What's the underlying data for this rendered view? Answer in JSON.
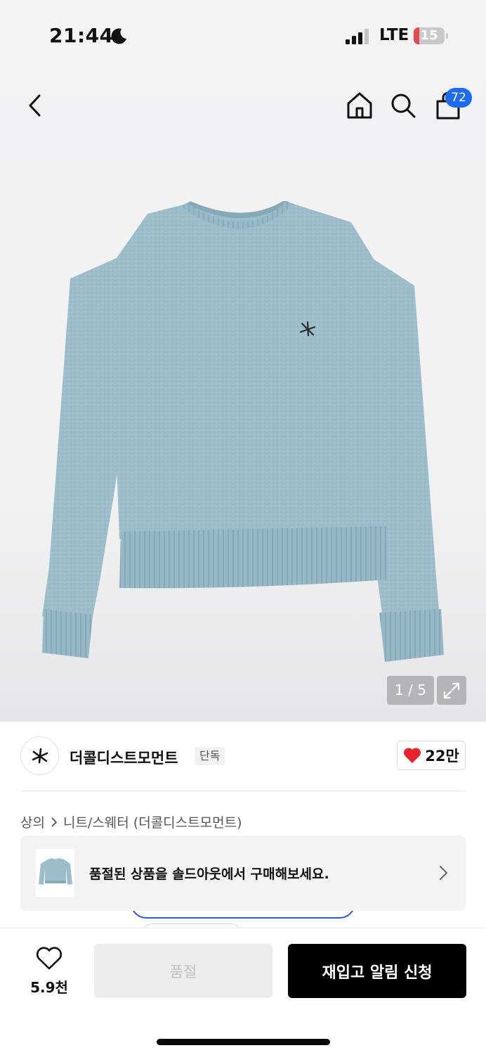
{
  "status_bar": {
    "time": "21:44",
    "network": "LTE",
    "battery": "15"
  },
  "nav": {
    "icons": [
      "chevron-left-icon",
      "home-icon",
      "search-icon",
      "cart-icon"
    ],
    "cart_count": "72"
  },
  "gallery": {
    "pager": "1 / 5",
    "current_index": 1,
    "total": 5
  },
  "brand": {
    "name": "더콜디스트모먼트",
    "tag": "단독",
    "like_count": "22만"
  },
  "breadcrumb": {
    "category": "상의",
    "subcategory": "니트/스웨터 (더콜디스트모먼트)"
  },
  "soldout_banner": {
    "text": "품절된 상품을 솔드아웃에서 구매해보세요."
  },
  "footer": {
    "wish_count": "5.9천",
    "soldout_label": "품절",
    "restock_label": "재입고 알림 신청"
  },
  "colors": {
    "accent_blue": "#1e6bf0",
    "heart_red": "#e8222b",
    "sweater_blue": "#9cbdcb"
  }
}
